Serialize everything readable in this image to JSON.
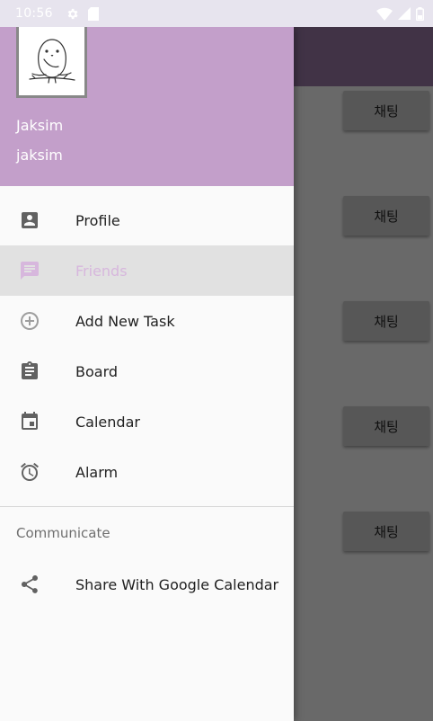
{
  "status_bar": {
    "time": "10:56"
  },
  "background": {
    "chat_buttons": [
      "채팅",
      "채팅",
      "채팅",
      "채팅",
      "채팅"
    ]
  },
  "drawer": {
    "header": {
      "name": "Jaksim",
      "subtitle": "jaksim"
    },
    "menu": [
      {
        "label": "Profile",
        "icon": "account-box-icon",
        "selected": false
      },
      {
        "label": "Friends",
        "icon": "message-icon",
        "selected": true
      },
      {
        "label": "Add New Task",
        "icon": "add-circle-icon",
        "selected": false
      },
      {
        "label": "Board",
        "icon": "clipboard-icon",
        "selected": false
      },
      {
        "label": "Calendar",
        "icon": "calendar-icon",
        "selected": false
      },
      {
        "label": "Alarm",
        "icon": "alarm-icon",
        "selected": false
      }
    ],
    "section_title": "Communicate",
    "section_items": [
      {
        "label": "Share With Google Calendar",
        "icon": "share-icon"
      }
    ]
  },
  "colors": {
    "header": "#c39fca",
    "selected_text": "#d7b7dd",
    "selected_bg": "#e1e1e1"
  }
}
